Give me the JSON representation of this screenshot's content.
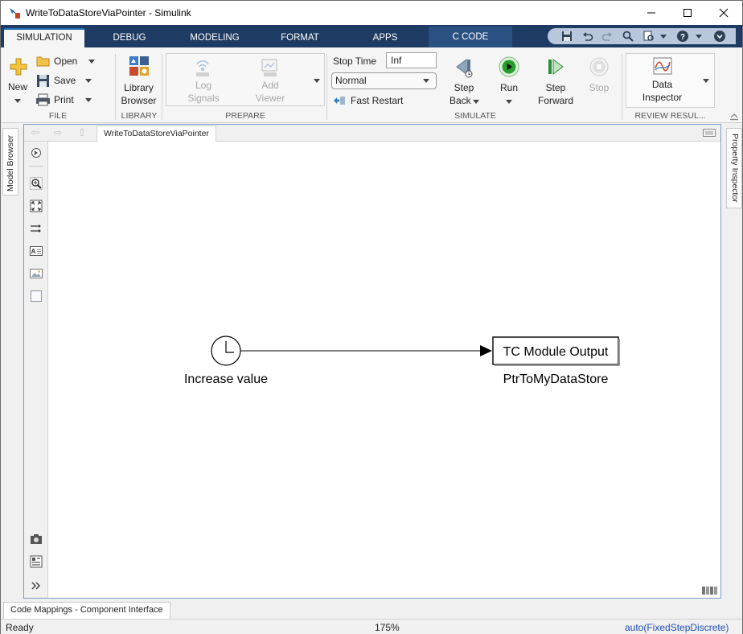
{
  "window": {
    "title": "WriteToDataStoreViaPointer - Simulink",
    "minimize_icon": "minimize-icon",
    "maximize_icon": "maximize-icon",
    "close_icon": "close-icon"
  },
  "tabs": [
    {
      "label": "SIMULATION",
      "active": true
    },
    {
      "label": "DEBUG"
    },
    {
      "label": "MODELING"
    },
    {
      "label": "FORMAT"
    },
    {
      "label": "APPS"
    },
    {
      "label": "C CODE"
    }
  ],
  "ribbon": {
    "file": {
      "label": "FILE",
      "new_label": "New",
      "open_label": "Open",
      "save_label": "Save",
      "print_label": "Print"
    },
    "library": {
      "label": "LIBRARY",
      "browser_line1": "Library",
      "browser_line2": "Browser"
    },
    "prepare": {
      "label": "PREPARE",
      "log_line1": "Log",
      "log_line2": "Signals",
      "viewer_line1": "Add",
      "viewer_line2": "Viewer"
    },
    "simulate": {
      "label": "SIMULATE",
      "stop_time_label": "Stop Time",
      "stop_time_value": "Inf",
      "mode_value": "Normal",
      "fast_restart_label": "Fast Restart",
      "step_back_line1": "Step",
      "step_back_line2": "Back",
      "run_label": "Run",
      "step_forward_line1": "Step",
      "step_forward_line2": "Forward",
      "stop_label": "Stop"
    },
    "review": {
      "label": "REVIEW RESUL...",
      "di_line1": "Data",
      "di_line2": "Inspector"
    }
  },
  "side_panels": {
    "left": "Model Browser",
    "right": "Property Inspector"
  },
  "editor": {
    "breadcrumb": "WriteToDataStoreViaPointer",
    "blocks": {
      "clock_label": "Increase value",
      "output_block_text": "TC Module Output",
      "output_block_label": "PtrToMyDataStore"
    }
  },
  "bottom": {
    "tab_label": "Code Mappings - Component Interface",
    "status": "Ready",
    "zoom": "175%",
    "solver": "auto(FixedStepDiscrete)"
  },
  "colors": {
    "tab_bar": "#1e3b63",
    "c_code_tab": "#2a5182",
    "accent": "#1f6fb7",
    "run_green": "#27a02d",
    "solver_blue": "#1f4fb7"
  }
}
